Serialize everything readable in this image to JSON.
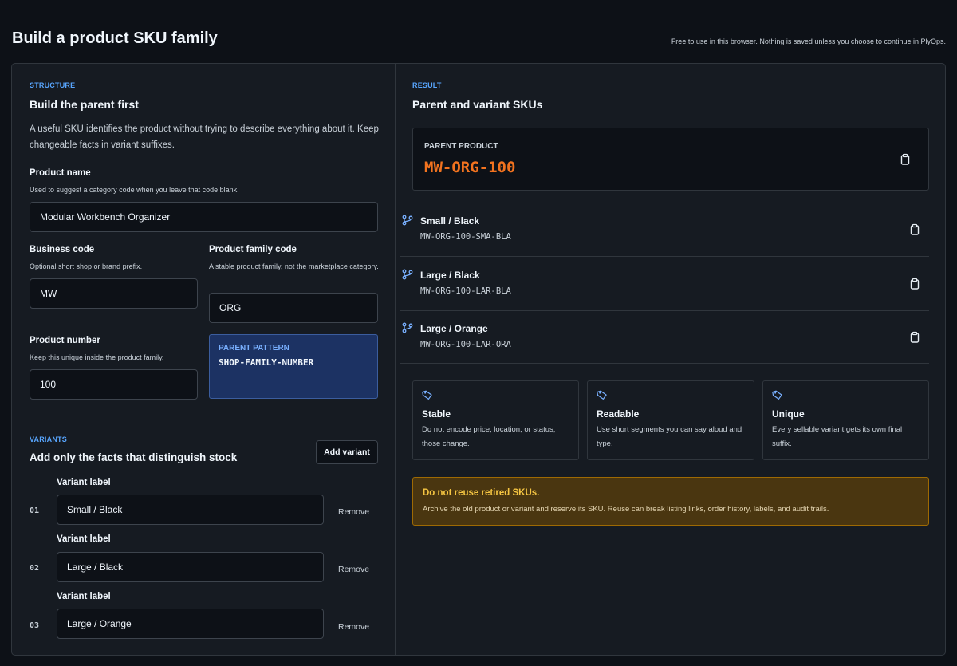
{
  "page": {
    "title": "Build a product SKU family",
    "note": "Free to use in this browser. Nothing is saved unless you choose to continue in PlyOps."
  },
  "structure": {
    "eyebrow": "STRUCTURE",
    "heading": "Build the parent first",
    "description": "A useful SKU identifies the product without trying to describe everything about it. Keep changeable facts in variant suffixes."
  },
  "fields": {
    "product_name": {
      "label": "Product name",
      "help": "Used to suggest a category code when you leave that code blank.",
      "value": "Modular Workbench Organizer"
    },
    "business_code": {
      "label": "Business code",
      "help": "Optional short shop or brand prefix.",
      "value": "MW"
    },
    "family_code": {
      "label": "Product family code",
      "help": "A stable product family, not the marketplace category.",
      "value": "ORG"
    },
    "product_number": {
      "label": "Product number",
      "help": "Keep this unique inside the product family.",
      "value": "100"
    }
  },
  "pattern": {
    "eyebrow": "PARENT PATTERN",
    "value": "SHOP-FAMILY-NUMBER"
  },
  "variants": {
    "eyebrow": "VARIANTS",
    "heading": "Add only the facts that distinguish stock",
    "add_label": "Add variant",
    "field_label": "Variant label",
    "remove_label": "Remove",
    "items": [
      {
        "index": "01",
        "value": "Small / Black"
      },
      {
        "index": "02",
        "value": "Large / Black"
      },
      {
        "index": "03",
        "value": "Large / Orange"
      }
    ]
  },
  "result": {
    "eyebrow": "RESULT",
    "heading": "Parent and variant SKUs",
    "parent_eyebrow": "PARENT PRODUCT",
    "parent_sku": "MW-ORG-100",
    "variants": [
      {
        "label": "Small / Black",
        "sku": "MW-ORG-100-SMA-BLA"
      },
      {
        "label": "Large / Black",
        "sku": "MW-ORG-100-LAR-BLA"
      },
      {
        "label": "Large / Orange",
        "sku": "MW-ORG-100-LAR-ORA"
      }
    ]
  },
  "principles": [
    {
      "title": "Stable",
      "text": "Do not encode price, location, or status; those change.",
      "icon": "tag-icon"
    },
    {
      "title": "Readable",
      "text": "Use short segments you can say aloud and type.",
      "icon": "tag-icon"
    },
    {
      "title": "Unique",
      "text": "Every sellable variant gets its own final suffix.",
      "icon": "tag-icon"
    }
  ],
  "warning": {
    "title": "Do not reuse retired SKUs.",
    "text": "Archive the old product or variant and reserve its SKU. Reuse can break listing links, order history, labels, and audit trails."
  },
  "colors": {
    "background": "#0d1117",
    "panel": "#161b22",
    "accent": "#58a6ff",
    "parent_sku": "#f2731f",
    "warning_bg": "#4a3610",
    "warning_title": "#f5c542",
    "pattern_bg": "#1c3263"
  }
}
